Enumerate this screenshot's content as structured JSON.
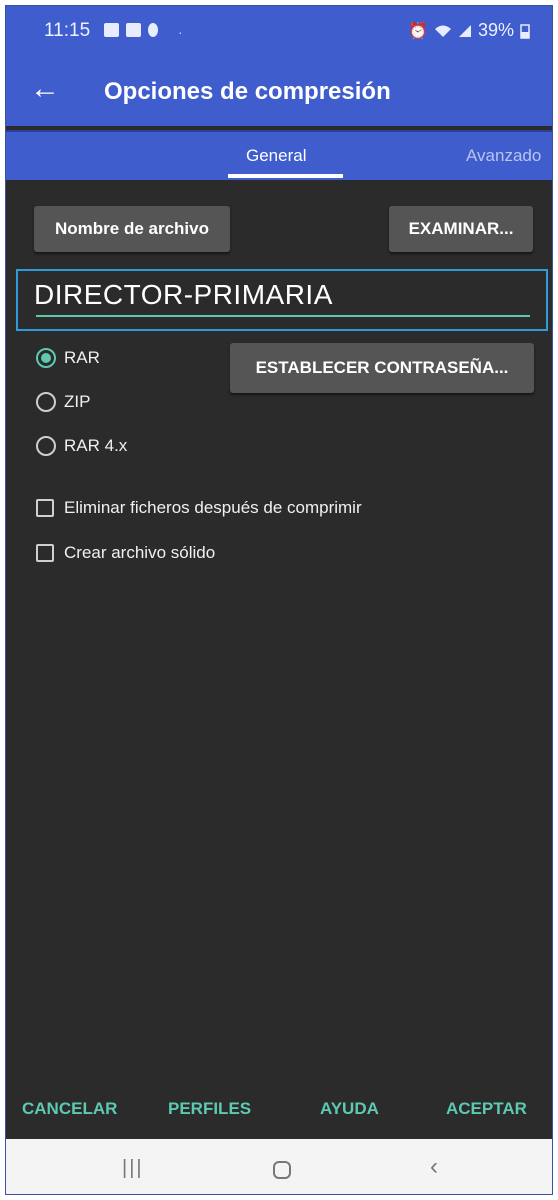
{
  "status_bar": {
    "time": "11:15",
    "battery_text": "39%"
  },
  "app_bar": {
    "title": "Opciones de compresión"
  },
  "tabs": [
    {
      "label": "General",
      "active": true
    },
    {
      "label": "Avanzado",
      "active": false
    }
  ],
  "general": {
    "filename_button": "Nombre de archivo",
    "browse_button": "EXAMINAR...",
    "filename_value": "DIRECTOR-PRIMARIA",
    "password_button": "ESTABLECER CONTRASEÑA...",
    "formats": [
      {
        "label": "RAR",
        "checked": true
      },
      {
        "label": "ZIP",
        "checked": false
      },
      {
        "label": "RAR 4.x",
        "checked": false
      }
    ],
    "options": [
      {
        "label": "Eliminar ficheros después de comprimir",
        "checked": false
      },
      {
        "label": "Crear archivo sólido",
        "checked": false
      }
    ]
  },
  "actions": {
    "cancel": "CANCELAR",
    "profiles": "PERFILES",
    "help": "AYUDA",
    "accept": "ACEPTAR"
  },
  "colors": {
    "accent": "#3f5dcc",
    "teal": "#5dc9b2",
    "background": "#2b2b2b"
  }
}
